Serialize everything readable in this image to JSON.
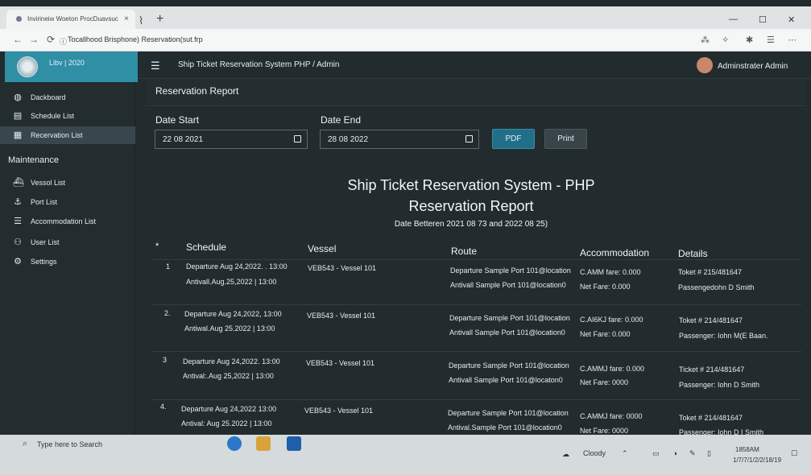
{
  "browser": {
    "tab_title": "Invirineiw Woeton ProcDuavsuc",
    "tab_close": "×",
    "new_tab": "+",
    "url": "Tocallhood Brisphone) Reservation(sut.frp"
  },
  "app": {
    "brand_name": "Libv | 2020",
    "header_title": "Ship Ticket Reservation System   PHP  /   Admin",
    "user_name": "Adminstrater Admin"
  },
  "sidebar": {
    "items": [
      {
        "label": "Dackboard",
        "icon": "dashboard-icon"
      },
      {
        "label": "Schedule List",
        "icon": "schedule-icon"
      },
      {
        "label": "Recervation List",
        "icon": "reservation-icon",
        "active": true
      }
    ],
    "section": "Maintenance",
    "maint_items": [
      {
        "label": "Vessol List",
        "icon": "vessel-icon"
      },
      {
        "label": "Port List",
        "icon": "port-icon"
      },
      {
        "label": "Accommodation List",
        "icon": "accommodation-icon"
      },
      {
        "label": "User List",
        "icon": "user-icon"
      },
      {
        "label": "Settings",
        "icon": "gear-icon"
      }
    ]
  },
  "page": {
    "card_title": "Reservation Report",
    "date_start_label": "Date Start",
    "date_start_value": "22 08 2021",
    "date_end_label": "Date End",
    "date_end_value": "28 08 2022",
    "pdf_label": "PDF",
    "print_label": "Print"
  },
  "report": {
    "system_title": "Ship Ticket Reservation System - PHP",
    "title": "Reservation Report",
    "subtitle": "Date Betteren 2021 08 73 and 2022 08 25)",
    "columns": [
      "*",
      "Schedule",
      "Vessel",
      "Route",
      "Accommodation",
      "Details"
    ],
    "rows": [
      {
        "num": "1",
        "departure": "Departure Aug 24,2022. . 13:00",
        "arrival": "Antivall.Aug.25,2022  |  13:00",
        "vessel": "VEB543 - Vessel 101",
        "route_dep": "Departure Sample Port 101@location",
        "route_arr": "Antivall Sample Port 101@location0",
        "acc": "C.AMM fare: 0.000",
        "net": "Net Fare: 0.000",
        "ticket": "Toket # 215/481647",
        "passenger": "Passengedohn D Smith"
      },
      {
        "num": "2.",
        "departure": "Departure Aug 24,2022, 13:00",
        "arrival": "Antiwal.Aug 25.2022  |  13:00",
        "vessel": "VEB543 - Vessel 101",
        "route_dep": "Departure Sample Port 101@location",
        "route_arr": "Antivall Sample Port 101@location0",
        "acc": "C.AI6KJ fare: 0.000",
        "net": "Net Fare: 0.000",
        "ticket": "Toket # 214/481647",
        "passenger": "Passenger: Iohn M(E Baan."
      },
      {
        "num": "3",
        "departure": "Departure Aug 24,2022. 13:00",
        "arrival": "Antival:.Aug 25,2022  |  13:00",
        "vessel": "VEB543 - Vessel 101",
        "route_dep": "Departure Sample Port 101@location",
        "route_arr": "Antivall Sample Port 101@locaton0",
        "acc": "C.AMMJ fare: 0.000",
        "net": "Net Fare: 0000",
        "ticket": "Ticket # 214/481647",
        "passenger": "Passenger: Iohn D Smith"
      },
      {
        "num": "4.",
        "departure": "Departure Aug 24,2022 13:00",
        "arrival": "Antival: Aug 25.2022  |  13:00",
        "vessel": "VEB543 - Vessel 101",
        "route_dep": "Departure Sample Port 101@location",
        "route_arr": "Antival.Sample Port 101@location0",
        "acc": "C.AMMJ fare: 0000",
        "net": "Net Fare: 0000",
        "ticket": "Toket # 214/481647",
        "passenger": "Passenger: Iohn D I Smith"
      }
    ]
  },
  "taskbar": {
    "search_placeholder": "Type here to Search",
    "weather": "Cloody",
    "time": "1858AM",
    "date": "1/7/7/1/2/2/18/19"
  }
}
